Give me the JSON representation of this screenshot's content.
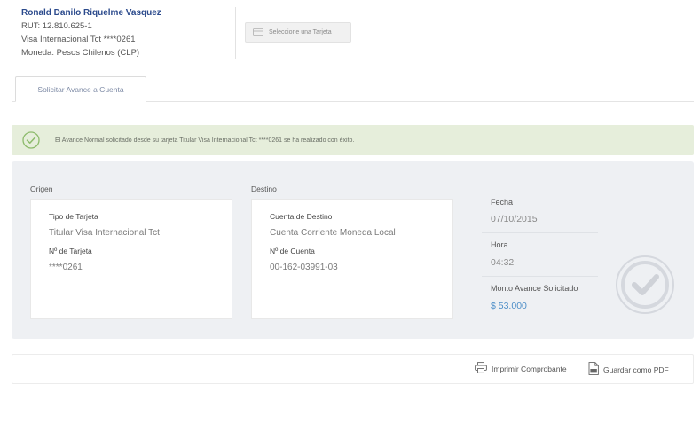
{
  "client": {
    "name": "Ronald Danilo Riquelme Vasquez",
    "rut": "RUT: 12.810.625-1",
    "card": "Visa Internacional Tct ****0261",
    "currency": "Moneda: Pesos Chilenos (CLP)"
  },
  "select_card_label": "Seleccione una Tarjeta",
  "tabs": [
    {
      "label": "Solicitar Avance a Cuenta"
    }
  ],
  "alert": {
    "message": "El Avance Normal solicitado desde su tarjeta Titular Visa Internacional Tct ****0261 se ha realizado con éxito."
  },
  "origin": {
    "section_label": "Origen",
    "card_type_label": "Tipo de Tarjeta",
    "card_type_value": "Titular Visa Internacional Tct",
    "card_number_label": "Nº de Tarjeta",
    "card_number_value": "****0261"
  },
  "destination": {
    "section_label": "Destino",
    "account_label": "Cuenta de Destino",
    "account_value": "Cuenta Corriente Moneda Local",
    "account_number_label": "Nº de Cuenta",
    "account_number_value": "00-162-03991-03"
  },
  "details": {
    "date_label": "Fecha",
    "date_value": "07/10/2015",
    "time_label": "Hora",
    "time_value": "04:32",
    "amount_label": "Monto Avance Solicitado",
    "amount_value": "$ 53.000"
  },
  "actions": {
    "print_label": "Imprimir Comprobante",
    "pdf_label": "Guardar como PDF"
  },
  "colors": {
    "name_blue": "#2b4a8c",
    "alert_bg": "#e6eedb",
    "alert_icon": "#8dbb6c",
    "amount_blue": "#4d8ec7",
    "panel_bg": "#eef0f3"
  },
  "icons": {
    "select_card": "credit-card-icon",
    "alert": "check-circle-icon",
    "stamp": "check-stamp-icon",
    "print": "printer-icon",
    "pdf": "pdf-file-icon"
  }
}
